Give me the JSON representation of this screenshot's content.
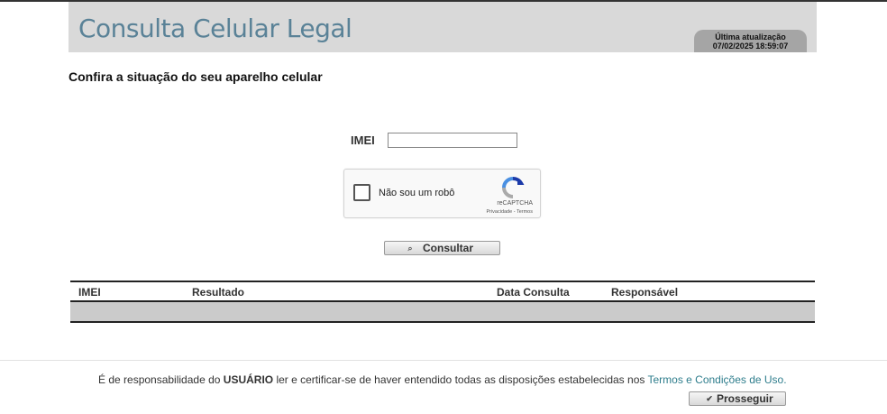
{
  "header": {
    "title": "Consulta Celular Legal",
    "update_label": "Última atualização",
    "update_time": "07/02/2025 18:59:07"
  },
  "heading": "Confira a situação do seu aparelho celular",
  "form": {
    "imei_label": "IMEI",
    "imei_value": "",
    "captcha_label": "Não sou um robô",
    "captcha_brand": "reCAPTCHA",
    "captcha_links": "Privacidade - Termos",
    "submit_label": "Consultar"
  },
  "table": {
    "columns": [
      "IMEI",
      "Resultado",
      "Data Consulta",
      "Responsável"
    ]
  },
  "footer": {
    "text_pre": "É de responsabilidade do ",
    "text_bold": "USUÁRIO",
    "text_mid": " ler e certificar-se de haver entendido todas as disposições estabelecidas nos ",
    "link": "Termos e Condições de Uso.",
    "proceed_label": "Prosseguir"
  }
}
